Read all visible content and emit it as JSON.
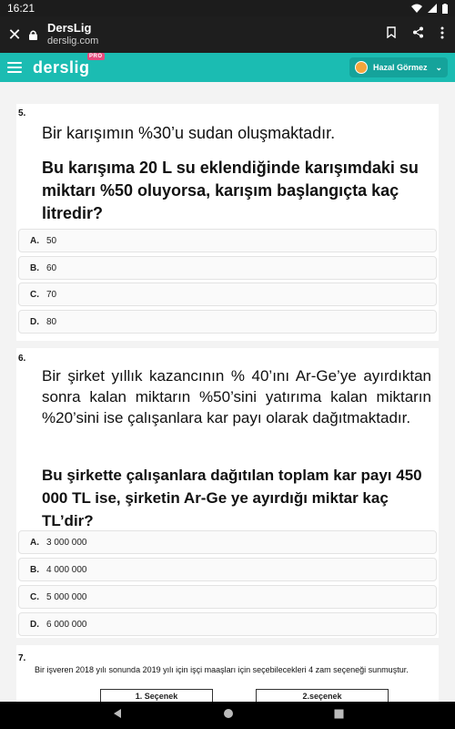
{
  "status_bar": {
    "time": "16:21"
  },
  "browser": {
    "title": "DersLig",
    "url": "derslig.com"
  },
  "app": {
    "logo": "derslig",
    "pro_badge": "PRO",
    "user_name": "Hazal Görmez"
  },
  "q5": {
    "number": "5.",
    "stem": "Bir karışımın %30’u sudan oluşmaktadır.",
    "question": "Bu karışıma 20 L su eklendiğinde karışımdaki su miktarı %50 oluyorsa, karışım başlangıçta kaç litredir?",
    "options": [
      {
        "letter": "A.",
        "value": "50"
      },
      {
        "letter": "B.",
        "value": "60"
      },
      {
        "letter": "C.",
        "value": "70"
      },
      {
        "letter": "D.",
        "value": "80"
      }
    ]
  },
  "q6": {
    "number": "6.",
    "stem": "Bir şirket yıllık kazancının % 40’ını Ar-Ge’ye ayırdıktan sonra kalan miktarın %50’sini yatırıma kalan miktarın %20’sini ise çalışanlara kar payı olarak dağıtmaktadır.",
    "question": "Bu şirkette çalışanlara dağıtılan toplam kar payı 450 000 TL ise, şirketin Ar-Ge ye ayırdığı miktar kaç TL’dir?",
    "options": [
      {
        "letter": "A.",
        "value": "3 000 000"
      },
      {
        "letter": "B.",
        "value": "4 000 000"
      },
      {
        "letter": "C.",
        "value": "5 000 000"
      },
      {
        "letter": "D.",
        "value": "6 000 000"
      }
    ]
  },
  "q7": {
    "number": "7.",
    "text": "Bir işveren 2018 yılı sonunda 2019 yılı için işçi maaşları için seçebilecekleri 4 zam seçeneği sunmuştur.",
    "headers": [
      "1. Seçenek",
      "2.seçenek"
    ]
  }
}
